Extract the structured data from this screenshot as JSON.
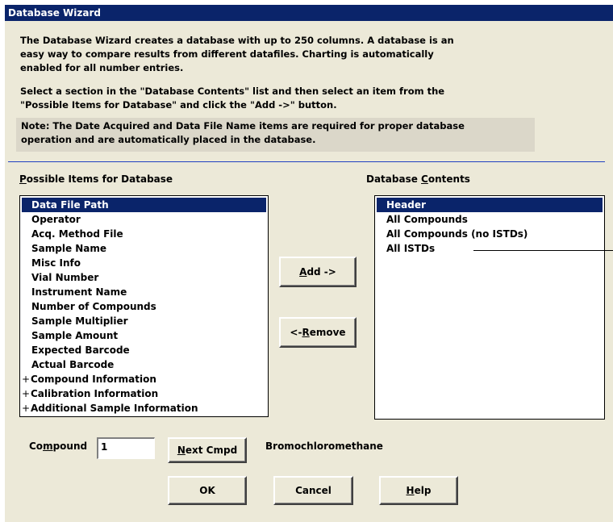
{
  "window": {
    "title": "Database Wizard"
  },
  "description": {
    "line1": "The Database Wizard creates a database with up to 250 columns.  A database is an",
    "line2": "easy way to compare results from different datafiles.  Charting is automatically",
    "line3": "enabled for all number entries.",
    "line4": "Select a section in the \"Database Contents\" list and then select an item from the",
    "line5": "\"Possible Items for Database\" and click the \"Add ->\" button."
  },
  "note": {
    "line1": "Note: The Date Acquired and Data File Name items are required for proper database",
    "line2": "operation and are automatically placed in the database."
  },
  "possible_items": {
    "label_prefix": "",
    "label_mnemonic": "P",
    "label_rest": "ossible Items for Database",
    "items": [
      {
        "label": "Data File Path",
        "selected": true
      },
      {
        "label": "Operator"
      },
      {
        "label": "Acq. Method File"
      },
      {
        "label": "Sample Name"
      },
      {
        "label": "Misc Info"
      },
      {
        "label": "Vial Number"
      },
      {
        "label": "Instrument Name"
      },
      {
        "label": "Number of Compounds"
      },
      {
        "label": "Sample Multiplier"
      },
      {
        "label": "Sample Amount"
      },
      {
        "label": "Expected Barcode"
      },
      {
        "label": "Actual Barcode"
      }
    ],
    "groups": [
      {
        "expander": "+",
        "label": "Compound Information"
      },
      {
        "expander": "+",
        "label": "Calibration Information"
      },
      {
        "expander": "+",
        "label": "Additional Sample Information"
      }
    ]
  },
  "database_contents": {
    "label_prefix": "Database ",
    "label_mnemonic": "C",
    "label_rest": "ontents",
    "items": [
      {
        "label": "Header",
        "selected": true
      },
      {
        "label": "All Compounds"
      },
      {
        "label": "All Compounds (no ISTDs)"
      },
      {
        "label": "All ISTDs"
      }
    ]
  },
  "buttons": {
    "add": {
      "mnemonic": "A",
      "rest": "dd ->"
    },
    "remove": {
      "prefix": "<- ",
      "mnemonic": "R",
      "rest": "emove"
    },
    "next_cmpd": {
      "mnemonic": "N",
      "rest": "ext Cmpd"
    },
    "ok": "OK",
    "cancel": "Cancel",
    "help": {
      "mnemonic": "H",
      "rest": "elp"
    }
  },
  "compound": {
    "label_prefix": "Co",
    "label_mnemonic": "m",
    "label_rest": "pound",
    "value": "1",
    "name": "Bromochloromethane"
  },
  "colors": {
    "titlebar": "#0a246a",
    "dialog_bg": "#ece9d8",
    "note_bg": "#dbd7c9",
    "separator": "#2040c0",
    "selection": "#0a246a"
  }
}
